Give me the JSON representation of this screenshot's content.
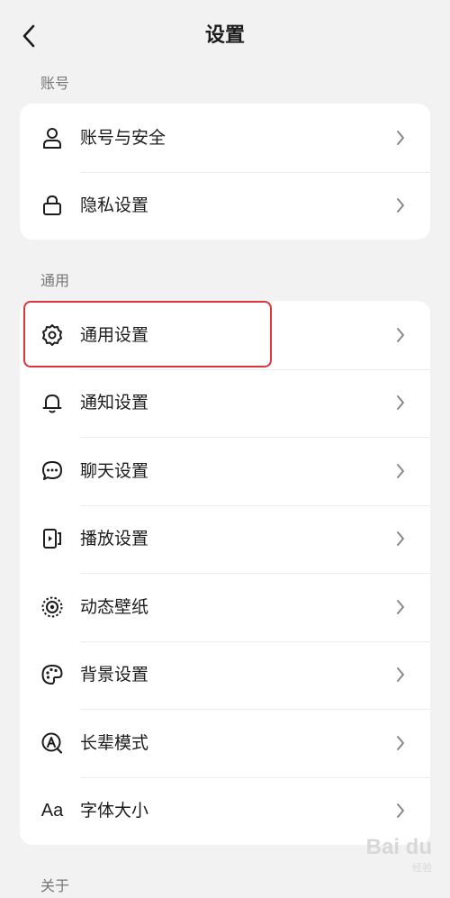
{
  "header": {
    "title": "设置"
  },
  "sections": {
    "account": {
      "label": "账号",
      "items": [
        {
          "label": "账号与安全",
          "icon": "user-icon"
        },
        {
          "label": "隐私设置",
          "icon": "lock-icon"
        }
      ]
    },
    "general": {
      "label": "通用",
      "items": [
        {
          "label": "通用设置",
          "icon": "gear-icon"
        },
        {
          "label": "通知设置",
          "icon": "bell-icon"
        },
        {
          "label": "聊天设置",
          "icon": "chat-bubble-icon"
        },
        {
          "label": "播放设置",
          "icon": "play-screen-icon"
        },
        {
          "label": "动态壁纸",
          "icon": "live-wallpaper-icon"
        },
        {
          "label": "背景设置",
          "icon": "palette-icon"
        },
        {
          "label": "长辈模式",
          "icon": "elder-mode-icon"
        },
        {
          "label": "字体大小",
          "icon": "font-size-icon",
          "icon_text": "Aa"
        }
      ]
    },
    "about": {
      "label": "关于"
    }
  },
  "highlight": {
    "target": "通用设置",
    "color": "#d9363e"
  },
  "watermark": {
    "text": "Bai du",
    "sub": "经验"
  }
}
